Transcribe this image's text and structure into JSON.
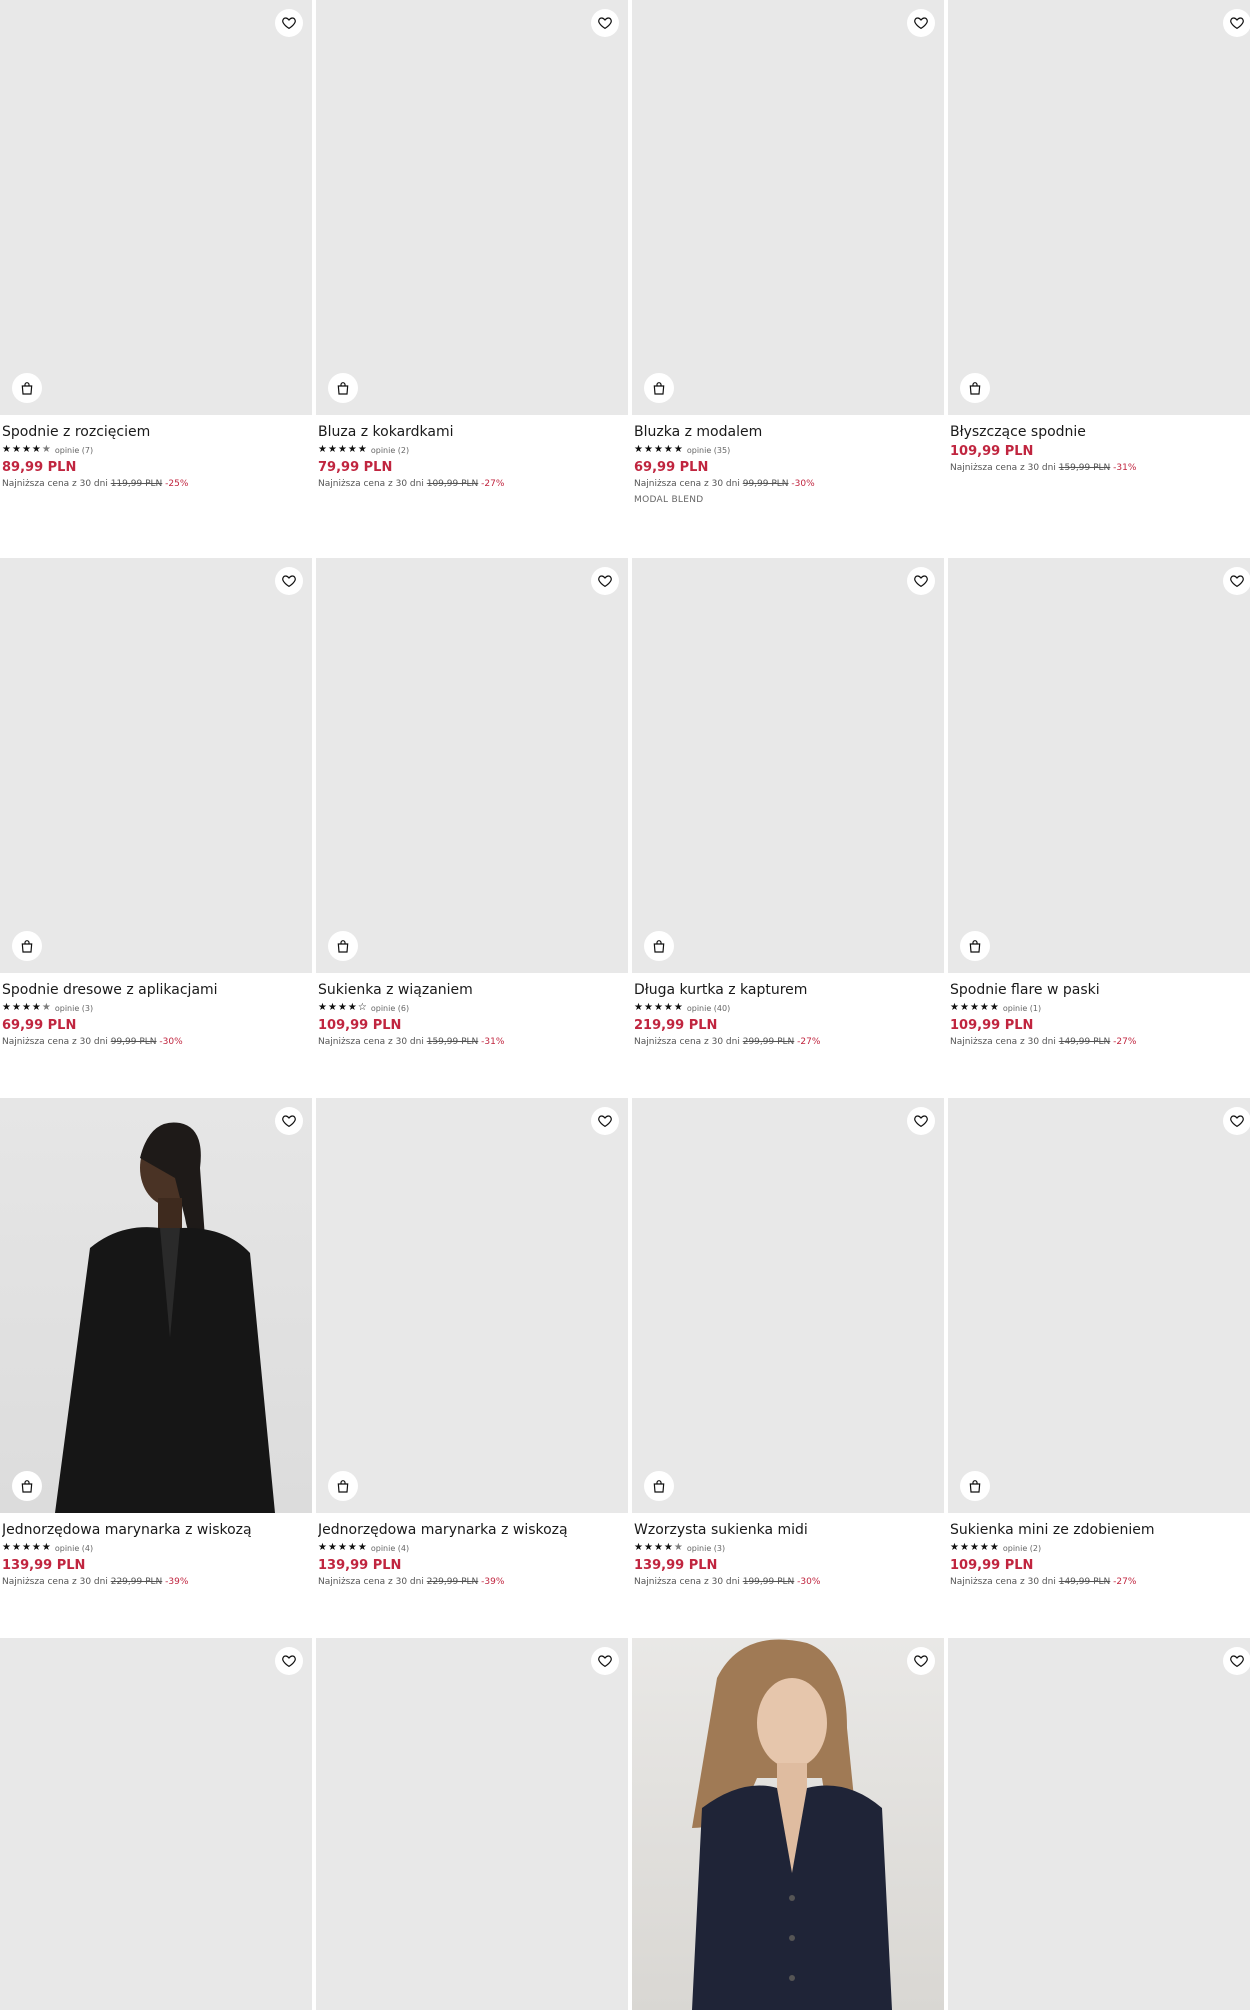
{
  "lowest_prefix": "Najniższa cena z 30 dni",
  "products": [
    {
      "name": "Spodnie z rozcięciem",
      "stars": 4.5,
      "reviews": "opinie (7)",
      "price": "89,99 PLN",
      "old": "119,99 PLN",
      "disc": "-25%",
      "tag": ""
    },
    {
      "name": "Bluza z kokardkami",
      "stars": 5,
      "reviews": "opinie (2)",
      "price": "79,99 PLN",
      "old": "109,99 PLN",
      "disc": "-27%",
      "tag": ""
    },
    {
      "name": "Bluzka z modalem",
      "stars": 5,
      "reviews": "opinie (35)",
      "price": "69,99 PLN",
      "old": "99,99 PLN",
      "disc": "-30%",
      "tag": "MODAL BLEND"
    },
    {
      "name": "Błyszczące spodnie",
      "stars": 0,
      "reviews": "",
      "price": "109,99 PLN",
      "old": "159,99 PLN",
      "disc": "-31%",
      "tag": ""
    },
    {
      "name": "Spodnie dresowe z aplikacjami",
      "stars": 4.5,
      "reviews": "opinie (3)",
      "price": "69,99 PLN",
      "old": "99,99 PLN",
      "disc": "-30%",
      "tag": ""
    },
    {
      "name": "Sukienka z wiązaniem",
      "stars": 4,
      "reviews": "opinie (6)",
      "price": "109,99 PLN",
      "old": "159,99 PLN",
      "disc": "-31%",
      "tag": ""
    },
    {
      "name": "Długa kurtka z kapturem",
      "stars": 5,
      "reviews": "opinie (40)",
      "price": "219,99 PLN",
      "old": "299,99 PLN",
      "disc": "-27%",
      "tag": ""
    },
    {
      "name": "Spodnie flare w paski",
      "stars": 5,
      "reviews": "opinie (1)",
      "price": "109,99 PLN",
      "old": "149,99 PLN",
      "disc": "-27%",
      "tag": ""
    },
    {
      "name": "Jednorzędowa marynarka z wiskozą",
      "stars": 5,
      "reviews": "opinie (4)",
      "price": "139,99 PLN",
      "old": "229,99 PLN",
      "disc": "-39%",
      "tag": ""
    },
    {
      "name": "Jednorzędowa marynarka z wiskozą",
      "stars": 5,
      "reviews": "opinie (4)",
      "price": "139,99 PLN",
      "old": "229,99 PLN",
      "disc": "-39%",
      "tag": ""
    },
    {
      "name": "Wzorzysta sukienka midi",
      "stars": 4.5,
      "reviews": "opinie (3)",
      "price": "139,99 PLN",
      "old": "199,99 PLN",
      "disc": "-30%",
      "tag": ""
    },
    {
      "name": "Sukienka mini ze zdobieniem",
      "stars": 5,
      "reviews": "opinie (2)",
      "price": "109,99 PLN",
      "old": "149,99 PLN",
      "disc": "-27%",
      "tag": ""
    }
  ],
  "icons": {
    "wishlist": "heart-icon",
    "cart": "shopping-bag-icon"
  },
  "colors": {
    "price": "#c0253f",
    "placeholder": "#e8e8e8"
  }
}
